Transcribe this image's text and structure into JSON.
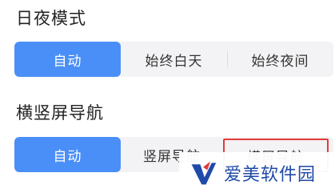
{
  "day_night": {
    "title": "日夜模式",
    "options": [
      "自动",
      "始终白天",
      "始终夜间"
    ],
    "selected": "自动"
  },
  "orientation": {
    "title": "横竖屏导航",
    "options": [
      "自动",
      "竖屏导航",
      "横屏导航"
    ],
    "selected": "自动"
  },
  "watermark": {
    "text": "爱美软件园"
  },
  "colors": {
    "accent": "#4a8ff7",
    "segment_bg": "#f3f3f5",
    "highlight_outline": "#e23a3a",
    "watermark_text": "#1f4aa8"
  }
}
